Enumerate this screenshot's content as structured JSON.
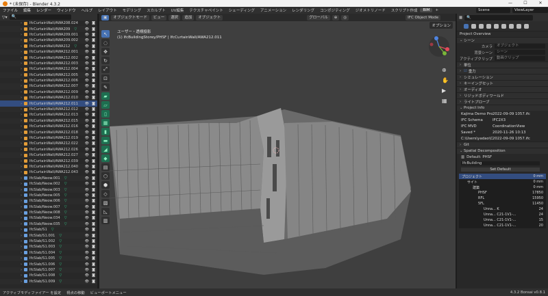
{
  "title": "* (未保存) - Blender 4.3.2",
  "window_controls": [
    "—",
    "☐",
    "✕"
  ],
  "menu": [
    "ファイル",
    "編集",
    "レンダー",
    "ウィンドウ",
    "ヘルプ"
  ],
  "workspaces": [
    "レイアウト",
    "モデリング",
    "スカルプト",
    "UV編集",
    "テクスチャペイント",
    "シェーディング",
    "アニメーション",
    "レンダリング",
    "コンポジティング",
    "ジオメトリノード",
    "スクリプト作成",
    "BIM",
    "+"
  ],
  "scene": "Scene",
  "viewlayer": "ViewLayer",
  "outliner": {
    "rows": [
      {
        "name": "IfcCurtainWall/AWA208.024",
        "type": "wall"
      },
      {
        "name": "IfcCurtainWall/AWA209",
        "type": "wall-tri"
      },
      {
        "name": "IfcCurtainWall/AWA209.001",
        "type": "wall"
      },
      {
        "name": "IfcCurtainWall/AWA209.002",
        "type": "wall"
      },
      {
        "name": "IfcCurtainWall/AWA212",
        "type": "wall-tri"
      },
      {
        "name": "IfcCurtainWall/AWA212.001",
        "type": "wall"
      },
      {
        "name": "IfcCurtainWall/AWA212.002",
        "type": "wall"
      },
      {
        "name": "IfcCurtainWall/AWA212.003",
        "type": "wall"
      },
      {
        "name": "IfcCurtainWall/AWA212.004",
        "type": "wall"
      },
      {
        "name": "IfcCurtainWall/AWA212.005",
        "type": "wall"
      },
      {
        "name": "IfcCurtainWall/AWA212.006",
        "type": "wall"
      },
      {
        "name": "IfcCurtainWall/AWA212.007",
        "type": "wall"
      },
      {
        "name": "IfcCurtainWall/AWA212.009",
        "type": "wall"
      },
      {
        "name": "IfcCurtainWall/AWA212.010",
        "type": "wall"
      },
      {
        "name": "IfcCurtainWall/AWA212.011",
        "type": "wall",
        "selected": true
      },
      {
        "name": "IfcCurtainWall/AWA212.012",
        "type": "wall"
      },
      {
        "name": "IfcCurtainWall/AWA212.013",
        "type": "wall"
      },
      {
        "name": "IfcCurtainWall/AWA212.015",
        "type": "wall"
      },
      {
        "name": "IfcCurtainWall/AWA212.016",
        "type": "wall"
      },
      {
        "name": "IfcCurtainWall/AWA212.018",
        "type": "wall"
      },
      {
        "name": "IfcCurtainWall/AWA212.019",
        "type": "wall"
      },
      {
        "name": "IfcCurtainWall/AWA212.022",
        "type": "wall"
      },
      {
        "name": "IfcCurtainWall/AWA212.026",
        "type": "wall"
      },
      {
        "name": "IfcCurtainWall/AWA212.027",
        "type": "wall"
      },
      {
        "name": "IfcCurtainWall/AWA212.039",
        "type": "wall"
      },
      {
        "name": "IfcCurtainWall/AWA212.040",
        "type": "wall"
      },
      {
        "name": "IfcCurtainWall/AWA212.043",
        "type": "wall"
      },
      {
        "name": "IfcSlab/Neow.001",
        "type": "slab-tri"
      },
      {
        "name": "IfcSlab/Neow.002",
        "type": "slab-tri"
      },
      {
        "name": "IfcSlab/Neow.003",
        "type": "slab-tri"
      },
      {
        "name": "IfcSlab/Neow.005",
        "type": "slab-tri"
      },
      {
        "name": "IfcSlab/Neow.006",
        "type": "slab-tri"
      },
      {
        "name": "IfcSlab/Neow.007",
        "type": "slab-tri"
      },
      {
        "name": "IfcSlab/Neow.008",
        "type": "slab-tri"
      },
      {
        "name": "IfcSlab/Neow.034",
        "type": "slab-tri"
      },
      {
        "name": "IfcSlab/Neow.035",
        "type": "slab-tri"
      },
      {
        "name": "IfcSlab/S1",
        "type": "slab-tri"
      },
      {
        "name": "IfcSlab/S1.001",
        "type": "slab-tri"
      },
      {
        "name": "IfcSlab/S1.002",
        "type": "slab-tri"
      },
      {
        "name": "IfcSlab/S1.003",
        "type": "slab-tri"
      },
      {
        "name": "IfcSlab/S1.004",
        "type": "slab-tri"
      },
      {
        "name": "IfcSlab/S1.005",
        "type": "slab-tri"
      },
      {
        "name": "IfcSlab/S1.006",
        "type": "slab-tri"
      },
      {
        "name": "IfcSlab/S1.007",
        "type": "slab-tri"
      },
      {
        "name": "IfcSlab/S1.008",
        "type": "slab-tri"
      },
      {
        "name": "IfcSlab/S1.009",
        "type": "slab-tri"
      }
    ]
  },
  "viewport": {
    "mode": "オブジェクトモード",
    "view_menu": [
      "ビュー",
      "選択",
      "追加",
      "オブジェクト"
    ],
    "orientation": "グローバル",
    "ifc_mode": "IFC Object Mode",
    "info_line1": "ユーザー・透視投影",
    "info_line2": "(1) IfcBuildingStorey/PHSF | IfcCurtainWall/AWA212.011",
    "options": "オプション"
  },
  "properties": {
    "section_title": "Project Overview",
    "scene_panel": "シーン",
    "camera_label": "カメラ",
    "camera_value": "オブジェクト",
    "bg_scene_label": "背景シーン",
    "bg_scene_value": "シーン",
    "active_clip_label": "アクティブクリップ",
    "active_clip_value": "動画クリップ",
    "panels": [
      "単位",
      "重力",
      "シミュレーション",
      "キーイングセット",
      "オーディオ",
      "リジッドボディワールド",
      "ライトプローブ"
    ],
    "project_info": "Project Info",
    "info": [
      {
        "k": "Kajima Demo Project.H...",
        "v": "2022-09-09 1057.ifc"
      },
      {
        "k": "IFC Schema",
        "v": "IFC2X3"
      },
      {
        "k": "IFC MVD",
        "v": "CoordinationView"
      },
      {
        "k": "Saved *",
        "v": "2020-11-26 10:13"
      },
      {
        "k": "C:\\Users\\yadao\\OneDriv...",
        "v": "2022-09-09 1057.ifc"
      }
    ],
    "git": "Git",
    "spatial": "Spatial Decomposition",
    "default_phsf": "Default: PHSF",
    "ifcbuilding": "IfcBuilding",
    "set_default": "Set Default",
    "tree": [
      {
        "n": "プロジェクト",
        "num": "0 mm",
        "indent": 0,
        "sel": true
      },
      {
        "n": "サイト",
        "num": "0 mm",
        "indent": 1
      },
      {
        "n": "建築",
        "num": "0 mm",
        "indent": 2
      },
      {
        "n": "PHSF",
        "num": "17850",
        "indent": 3
      },
      {
        "n": "RFL",
        "num": "15950",
        "indent": 3
      },
      {
        "n": "5FL",
        "num": "11450",
        "indent": 3
      },
      {
        "n": "Unna... K",
        "num": "24",
        "indent": 4
      },
      {
        "n": "Unna... C21-1V1-...",
        "num": "24",
        "indent": 4
      },
      {
        "n": "Unna... C21-1V1-...",
        "num": "15",
        "indent": 4
      },
      {
        "n": "Unna... C21-1V1-...",
        "num": "20",
        "indent": 4
      }
    ]
  },
  "status": {
    "left": [
      "アクティブモディファイアー を設定",
      "視点の移動",
      "ビューポートメニュー"
    ],
    "version": "4.3.2  Bonsai v0.8.1"
  }
}
